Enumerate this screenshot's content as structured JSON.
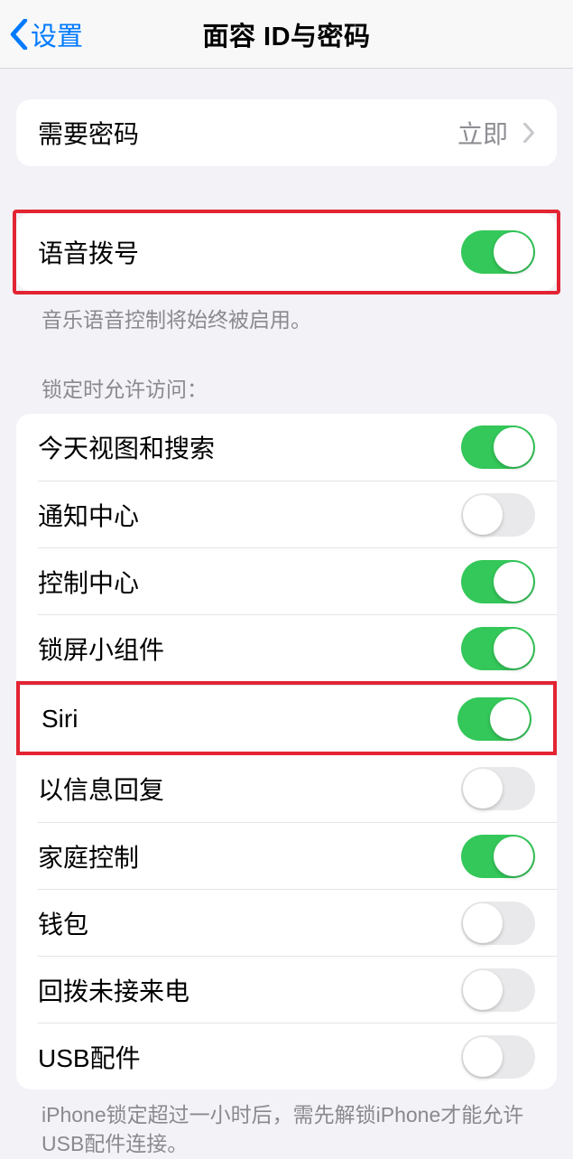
{
  "nav": {
    "back_label": "设置",
    "title": "面容 ID与密码"
  },
  "require_passcode": {
    "label": "需要密码",
    "value": "立即"
  },
  "voice_dial": {
    "label": "语音拨号",
    "on": true,
    "footer": "音乐语音控制将始终被启用。"
  },
  "locked_access": {
    "header": "锁定时允许访问：",
    "items": [
      {
        "label": "今天视图和搜索",
        "on": true
      },
      {
        "label": "通知中心",
        "on": false
      },
      {
        "label": "控制中心",
        "on": true
      },
      {
        "label": "锁屏小组件",
        "on": true
      },
      {
        "label": "Siri",
        "on": true
      },
      {
        "label": "以信息回复",
        "on": false
      },
      {
        "label": "家庭控制",
        "on": true
      },
      {
        "label": "钱包",
        "on": false
      },
      {
        "label": "回拨未接来电",
        "on": false
      },
      {
        "label": "USB配件",
        "on": false
      }
    ],
    "footer": "iPhone锁定超过一小时后，需先解锁iPhone才能允许USB配件连接。"
  }
}
